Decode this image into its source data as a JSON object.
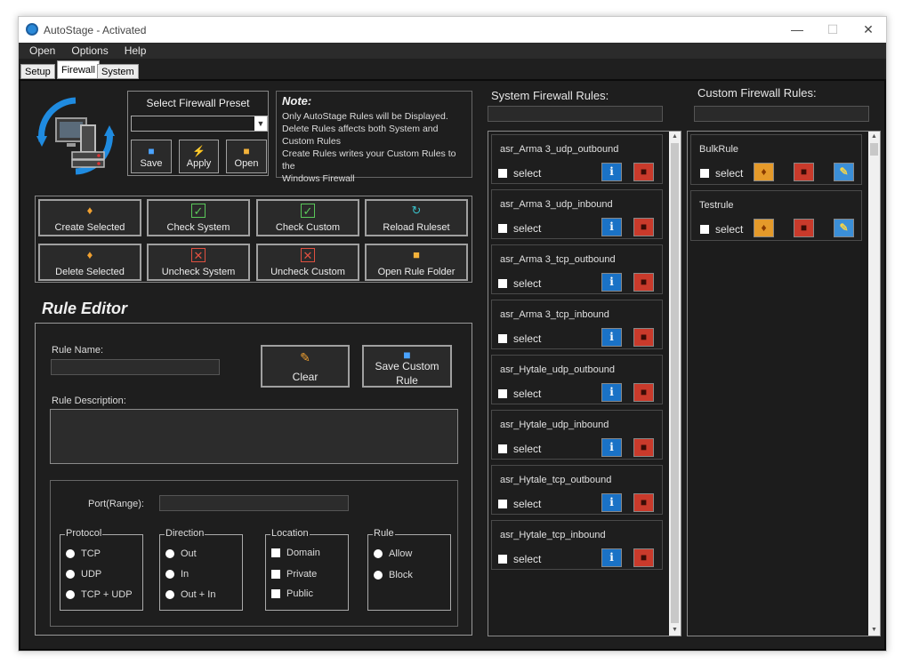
{
  "window": {
    "title": "AutoStage - Activated",
    "controls": {
      "minimize": "—",
      "maximize": "☐",
      "close": "✕"
    }
  },
  "menu": [
    "Open",
    "Options",
    "Help"
  ],
  "tabs": [
    "Setup",
    "Firewall",
    "System"
  ],
  "preset": {
    "title": "Select Firewall Preset",
    "selected": "",
    "buttons": {
      "save": "Save",
      "apply": "Apply",
      "open": "Open"
    }
  },
  "note": {
    "title": "Note:",
    "lines": [
      "Only AutoStage Rules will be Displayed.",
      "Delete Rules affects both System and",
      "Custom Rules",
      "Create Rules writes your Custom Rules to the",
      "Windows Firewall"
    ]
  },
  "actions": {
    "create_selected": "Create Selected",
    "check_system": "Check System",
    "check_custom": "Check Custom",
    "reload_ruleset": "Reload Ruleset",
    "delete_selected": "Delete Selected",
    "uncheck_system": "Uncheck System",
    "uncheck_custom": "Uncheck Custom",
    "open_rule_folder": "Open Rule Folder"
  },
  "editor": {
    "title": "Rule Editor",
    "rule_name_label": "Rule Name:",
    "rule_name_value": "",
    "clear_label": "Clear",
    "save_line1": "Save Custom",
    "save_line2": "Rule",
    "description_label": "Rule Description:",
    "description_value": "",
    "port_label": "Port(Range):",
    "port_value": "",
    "groups": {
      "protocol": {
        "title": "Protocol",
        "options": [
          "TCP",
          "UDP",
          "TCP + UDP"
        ]
      },
      "direction": {
        "title": "Direction",
        "options": [
          "Out",
          "In",
          "Out + In"
        ]
      },
      "location": {
        "title": "Location",
        "options": [
          "Domain",
          "Private",
          "Public"
        ]
      },
      "rule": {
        "title": "Rule",
        "options": [
          "Allow",
          "Block"
        ]
      }
    }
  },
  "system_rules": {
    "title": "System Firewall Rules:",
    "search": "",
    "select_label": "select",
    "items": [
      "asr_Arma 3_udp_outbound",
      "asr_Arma 3_udp_inbound",
      "asr_Arma 3_tcp_outbound",
      "asr_Arma 3_tcp_inbound",
      "asr_Hytale_udp_outbound",
      "asr_Hytale_udp_inbound",
      "asr_Hytale_tcp_outbound",
      "asr_Hytale_tcp_inbound"
    ]
  },
  "custom_rules": {
    "title": "Custom Firewall Rules:",
    "search": "",
    "select_label": "select",
    "items": [
      "BulkRule",
      "Testrule"
    ]
  },
  "colors": {
    "background": "#1e1e1e",
    "info_button": "#1a72c6",
    "delete_button": "#c93a2b",
    "logo_blue": "#1f8be0"
  },
  "icons": {
    "info": "i",
    "delete": "trash-icon",
    "edit": "pencil-icon",
    "bulk": "shield-icon"
  }
}
